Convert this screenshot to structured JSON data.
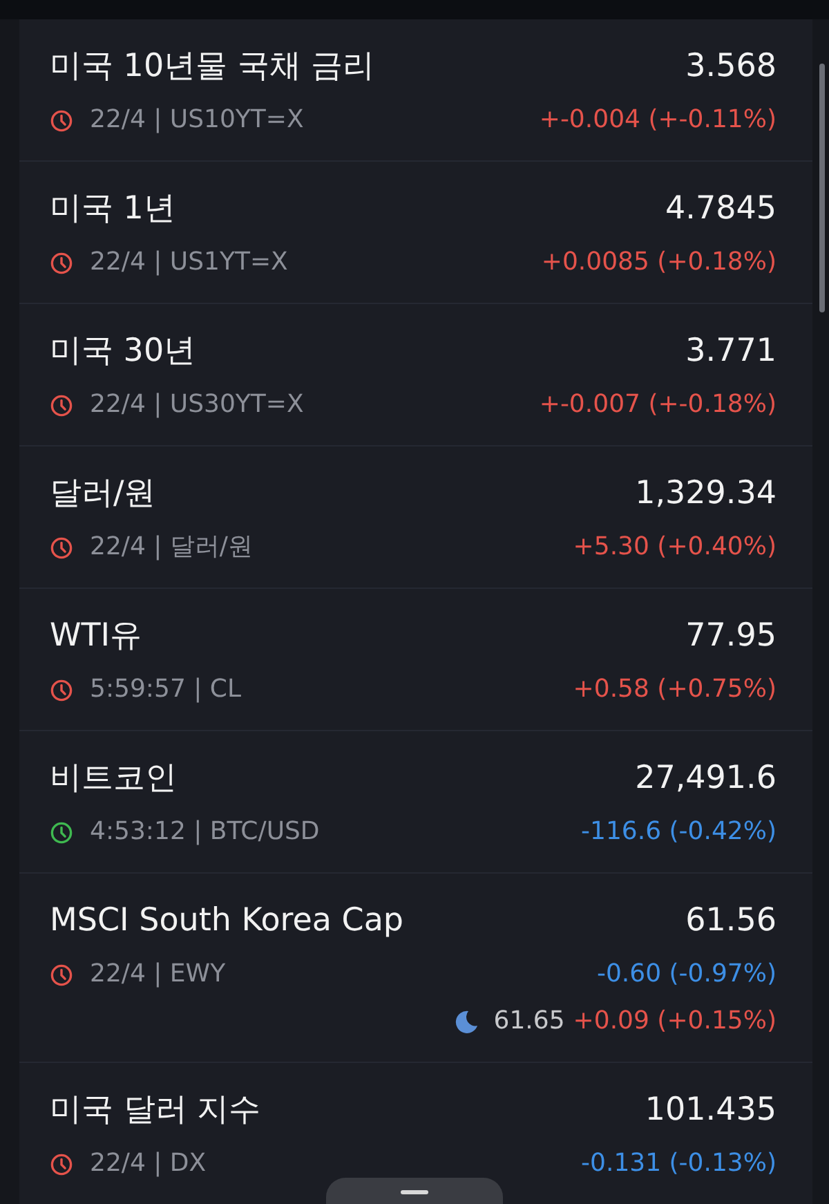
{
  "quotes": [
    {
      "name": "미국 10년물 국채 금리",
      "price": "3.568",
      "meta": "22/4 | US10YT=X",
      "market_open": false,
      "change": "+-0.004 (+-0.11%)",
      "color": "#e5534b"
    },
    {
      "name": "미국 1년",
      "price": "4.7845",
      "meta": "22/4 | US1YT=X",
      "market_open": false,
      "change": "+0.0085 (+0.18%)",
      "color": "#e5534b"
    },
    {
      "name": "미국 30년",
      "price": "3.771",
      "meta": "22/4 | US30YT=X",
      "market_open": false,
      "change": "+-0.007 (+-0.18%)",
      "color": "#e5534b"
    },
    {
      "name": "달러/원",
      "price": "1,329.34",
      "meta": "22/4 | 달러/원",
      "market_open": false,
      "change": "+5.30 (+0.40%)",
      "color": "#e5534b"
    },
    {
      "name": "WTI유",
      "price": "77.95",
      "meta": "5:59:57 | CL",
      "market_open": false,
      "change": "+0.58 (+0.75%)",
      "color": "#e5534b"
    },
    {
      "name": "비트코인",
      "price": "27,491.6",
      "meta": "4:53:12 | BTC/USD",
      "market_open": true,
      "change": "-116.6 (-0.42%)",
      "color": "#3d8fe6"
    },
    {
      "name": "MSCI South Korea Cap",
      "price": "61.56",
      "meta": "22/4 | EWY",
      "market_open": false,
      "change": "-0.60 (-0.97%)",
      "color": "#3d8fe6",
      "after_hours": {
        "price": "61.65",
        "change": "+0.09 (+0.15%)",
        "color": "#e5534b"
      }
    },
    {
      "name": "미국 달러 지수",
      "price": "101.435",
      "meta": "22/4 | DX",
      "market_open": false,
      "change": "-0.131 (-0.13%)",
      "color": "#3d8fe6"
    }
  ]
}
